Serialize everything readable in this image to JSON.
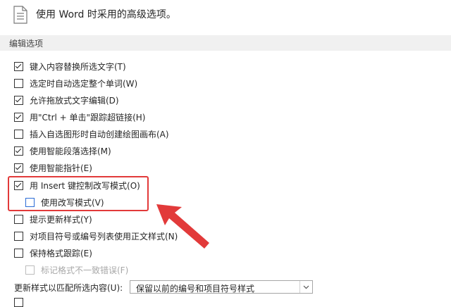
{
  "header": {
    "text": "使用 Word 时采用的高级选项。",
    "icon": "document-icon"
  },
  "section": {
    "title": "编辑选项"
  },
  "options": [
    {
      "label": "键入内容替换所选文字(T)",
      "checked": true
    },
    {
      "label": "选定时自动选定整个单词(W)",
      "checked": false
    },
    {
      "label": "允许拖放式文字编辑(D)",
      "checked": true
    },
    {
      "label": "用\"Ctrl + 单击\"跟踪超链接(H)",
      "checked": true
    },
    {
      "label": "插入自选图形时自动创建绘图画布(A)",
      "checked": false
    },
    {
      "label": "使用智能段落选择(M)",
      "checked": true
    },
    {
      "label": "使用智能指针(E)",
      "checked": true
    },
    {
      "label": "用 Insert 键控制改写模式(O)",
      "checked": true
    },
    {
      "label": "使用改写模式(V)",
      "checked": false
    },
    {
      "label": "提示更新样式(Y)",
      "checked": false
    },
    {
      "label": "对项目符号或编号列表使用正文样式(N)",
      "checked": false
    },
    {
      "label": "保持格式跟踪(E)",
      "checked": false
    },
    {
      "label": "标记格式不一致错误(F)",
      "checked": false
    }
  ],
  "update_style": {
    "label": "更新样式以匹配所选内容(U):",
    "value": "保留以前的编号和项目符号样式"
  },
  "colors": {
    "highlight": "#e23a3a",
    "accent": "#2b6cd6"
  }
}
